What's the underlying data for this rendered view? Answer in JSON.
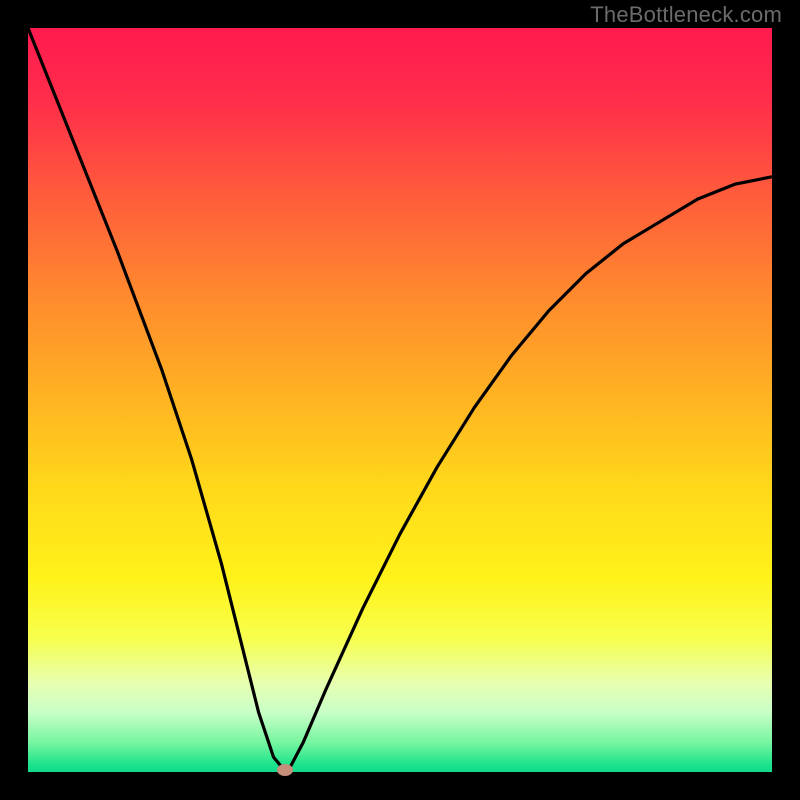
{
  "watermark": "TheBottleneck.com",
  "colors": {
    "page_bg": "#000000",
    "curve": "#000000",
    "dot": "#c58e7a",
    "gradient_top": "#ff1a4f",
    "gradient_bottom": "#0fd98a"
  },
  "chart_data": {
    "type": "line",
    "title": "",
    "xlabel": "",
    "ylabel": "",
    "xlim": [
      0,
      100
    ],
    "ylim": [
      0,
      100
    ],
    "grid": false,
    "legend": false,
    "series": [
      {
        "name": "bottleneck-curve",
        "x": [
          0,
          4,
          8,
          12,
          15,
          18,
          20,
          22,
          24,
          26,
          28,
          30,
          31,
          32,
          33,
          34,
          34.5,
          35,
          37,
          40,
          45,
          50,
          55,
          60,
          65,
          70,
          75,
          80,
          85,
          90,
          95,
          100
        ],
        "values": [
          100,
          90,
          80,
          70,
          62,
          54,
          48,
          42,
          35,
          28,
          20,
          12,
          8,
          5,
          2,
          0.8,
          0.3,
          0.2,
          4,
          11,
          22,
          32,
          41,
          49,
          56,
          62,
          67,
          71,
          74,
          77,
          79,
          80
        ]
      }
    ],
    "marker": {
      "x": 34.5,
      "y": 0.3,
      "color": "#c58e7a"
    },
    "background_gradient": {
      "orientation": "vertical",
      "stops": [
        {
          "pos": 0.0,
          "color": "#ff1a4f"
        },
        {
          "pos": 0.5,
          "color": "#ffd91a"
        },
        {
          "pos": 0.95,
          "color": "#78f5a0"
        },
        {
          "pos": 1.0,
          "color": "#0fd98a"
        }
      ]
    }
  }
}
